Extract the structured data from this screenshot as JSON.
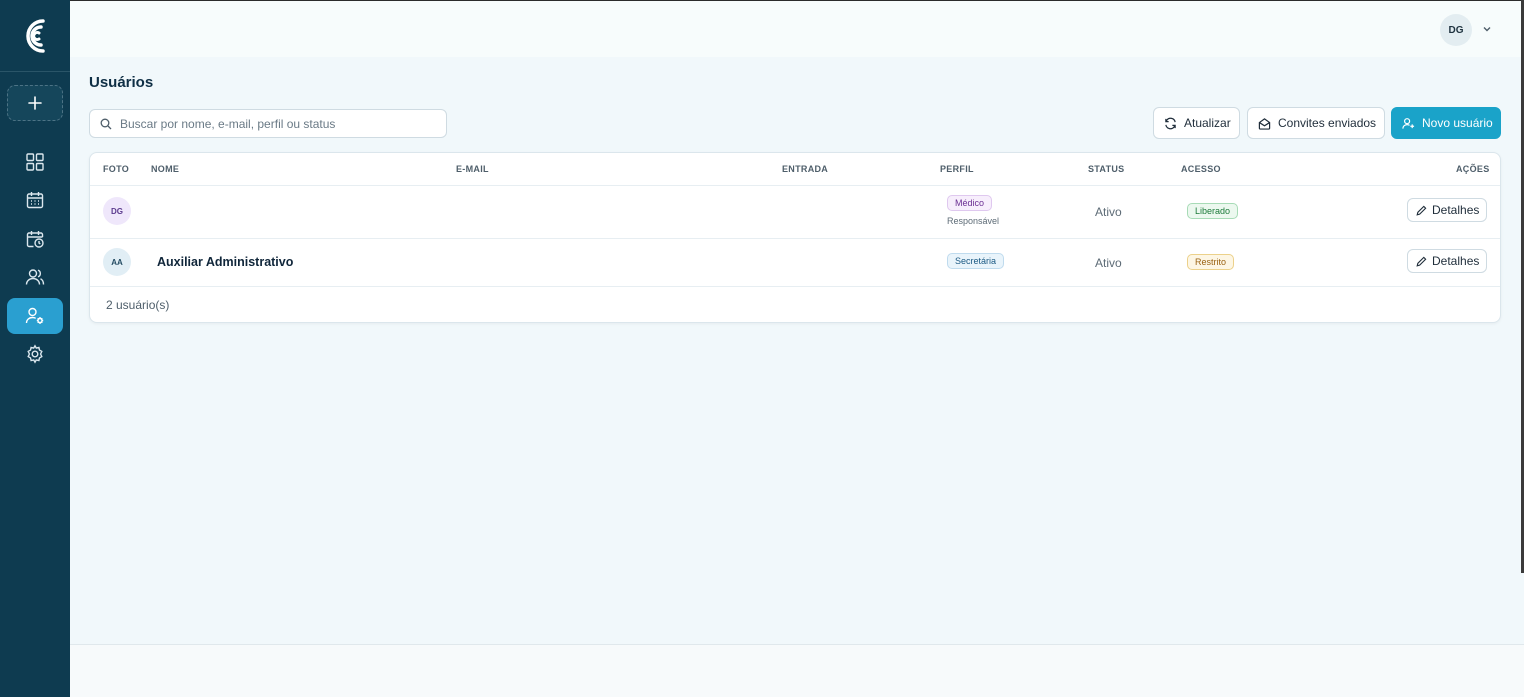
{
  "header": {
    "user_initials": "DG"
  },
  "page": {
    "title": "Usuários"
  },
  "search": {
    "placeholder": "Buscar por nome, e-mail, perfil ou status",
    "value": ""
  },
  "toolbar": {
    "refresh_label": "Atualizar",
    "invites_label": "Convites enviados",
    "new_user_label": "Novo usuário"
  },
  "table": {
    "columns": [
      "FOTO",
      "NOME",
      "E-MAIL",
      "ENTRADA",
      "PERFIL",
      "STATUS",
      "ACESSO",
      "AÇÕES"
    ],
    "rows": [
      {
        "initials": "DG",
        "name": "",
        "email": "",
        "entrada": "",
        "perfil": "Médico",
        "perfil_sub": "Responsável",
        "status": "Ativo",
        "acesso": "Liberado",
        "action": "Detalhes"
      },
      {
        "initials": "AA",
        "name": "Auxiliar Administrativo",
        "email": "",
        "entrada": "",
        "perfil": "Secretária",
        "perfil_sub": "",
        "status": "Ativo",
        "acesso": "Restrito",
        "action": "Detalhes"
      }
    ],
    "footer_count": "2 usuário(s)"
  },
  "sidebar": {
    "items": [
      {
        "icon": "dashboard-icon"
      },
      {
        "icon": "calendar-icon"
      },
      {
        "icon": "calendar-clock-icon"
      },
      {
        "icon": "users-icon"
      },
      {
        "icon": "user-settings-icon",
        "active": true
      },
      {
        "icon": "gear-icon"
      }
    ]
  },
  "colors": {
    "sidebar": "#0e3b50",
    "accent": "#1aa3c9",
    "active_nav": "#2a9fd0"
  }
}
